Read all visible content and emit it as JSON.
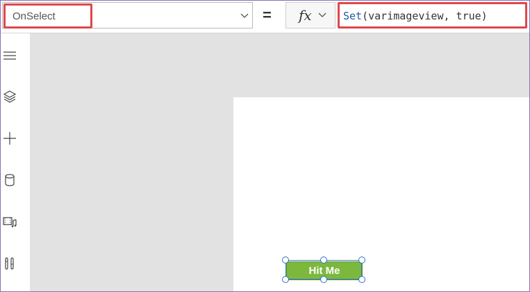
{
  "formula_bar": {
    "property": "OnSelect",
    "equals": "=",
    "fx_label": "fx",
    "formula_fn": "Set",
    "formula_args": "(varimageview, true)"
  },
  "left_rail": {
    "icons": [
      "menu-icon",
      "layers-icon",
      "add-icon",
      "database-icon",
      "media-icon",
      "tools-icon"
    ]
  },
  "canvas": {
    "button_label": "Hit Me"
  },
  "colors": {
    "highlight": "#e0464b",
    "button_fill": "#7db83e",
    "selection": "#2e6fc9",
    "canvas_bg": "#e2e2e2",
    "frame_border": "#8a6fb3"
  }
}
